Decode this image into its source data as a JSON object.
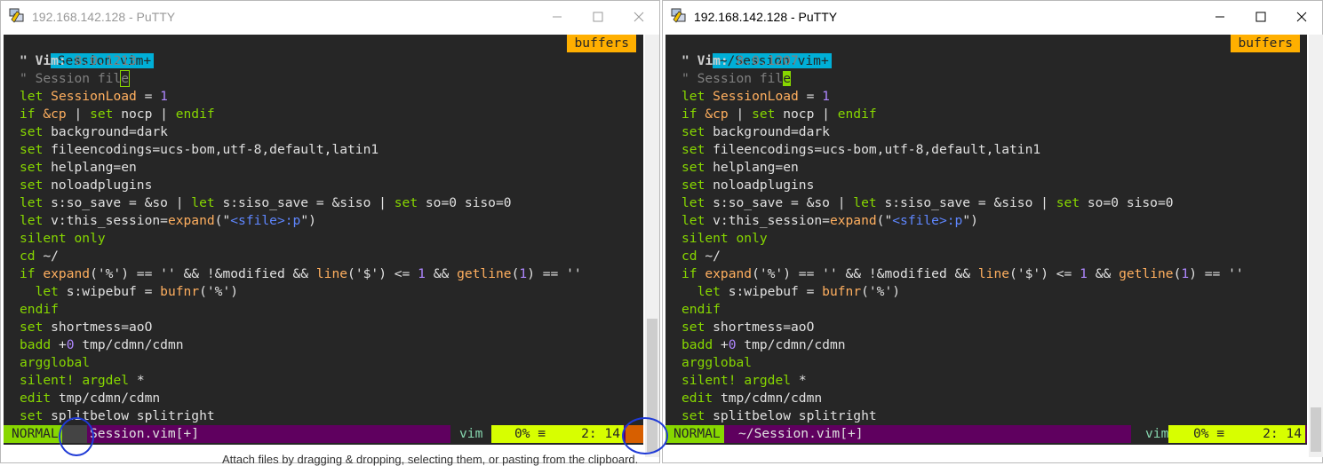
{
  "left": {
    "title": "192.168.142.128 - PuTTY",
    "tab_label": "Session.vim+",
    "buffers_label": "buffers",
    "vim_version_label": "\" Vim: ",
    "vim_version": "8.0.1213",
    "session_comment_a": "\" Session fil",
    "session_comment_b": "e",
    "status": {
      "mode": "NORMAL",
      "file": "Session.vim[+]",
      "ft": "vim",
      "percent": "0% ≡",
      "pos": "2: 14"
    }
  },
  "right": {
    "title": "192.168.142.128 - PuTTY",
    "tab_label": "~/Session.vim+",
    "buffers_label": "buffers",
    "vim_version_label": "\" Vim: ",
    "vim_version": "8.0.1207",
    "session_comment_a": "\" Session fil",
    "session_comment_b": "e",
    "status": {
      "mode": "NORMAL",
      "file": "~/Session.vim[+]",
      "ft": "vim",
      "percent": "0% ≡",
      "pos": "2: 14"
    }
  },
  "code": {
    "l3": [
      "let ",
      "SessionLoad",
      " = ",
      "1"
    ],
    "l4": [
      "if ",
      "&cp",
      " | ",
      "set",
      " nocp | ",
      "endif"
    ],
    "l5": [
      "set",
      " background=dark"
    ],
    "l6": [
      "set",
      " fileencodings=ucs-bom,utf-8,default,latin1"
    ],
    "l7": [
      "set",
      " helplang=en"
    ],
    "l8": [
      "set",
      " noloadplugins"
    ],
    "l9": [
      "let",
      " s:so_save = &so | ",
      "let",
      " s:siso_save = &siso | ",
      "set",
      " so=0 siso=0"
    ],
    "l10": [
      "let",
      " v:this_session=",
      "expand",
      "(\"",
      "<sfile>:p",
      "\")"
    ],
    "l11": [
      "silent",
      " ",
      "only"
    ],
    "l12": [
      "cd",
      " ~/"
    ],
    "l13": [
      "if ",
      "expand",
      "('%') == '' && !&modified && ",
      "line",
      "('$') <= ",
      "1",
      " && ",
      "getline",
      "(",
      "1",
      ") == ''"
    ],
    "l14": [
      "  let",
      " s:wipebuf = ",
      "bufnr",
      "('%')"
    ],
    "l15": [
      "endif"
    ],
    "l16": [
      "set",
      " shortmess=aoO"
    ],
    "l17": [
      "badd",
      " +",
      "0",
      " tmp/cdmn/cdmn"
    ],
    "l18": [
      "argglobal"
    ],
    "l19": [
      "silent!",
      " ",
      "argdel",
      " *"
    ],
    "l20": [
      "edit",
      " tmp/cdmn/cdmn"
    ],
    "l21": [
      "set",
      " splitbelow splitright"
    ]
  },
  "below_text": "Attach files by dragging & dropping, selecting them, or pasting from the clipboard.",
  "colors": {
    "tab": "#00afd7",
    "buffers": "#ffaf00",
    "mode": "#87d700",
    "statusfile": "#5f005f",
    "pos": "#d7ff00",
    "error": "#d75f00",
    "annotation": "#1f3ad6"
  }
}
